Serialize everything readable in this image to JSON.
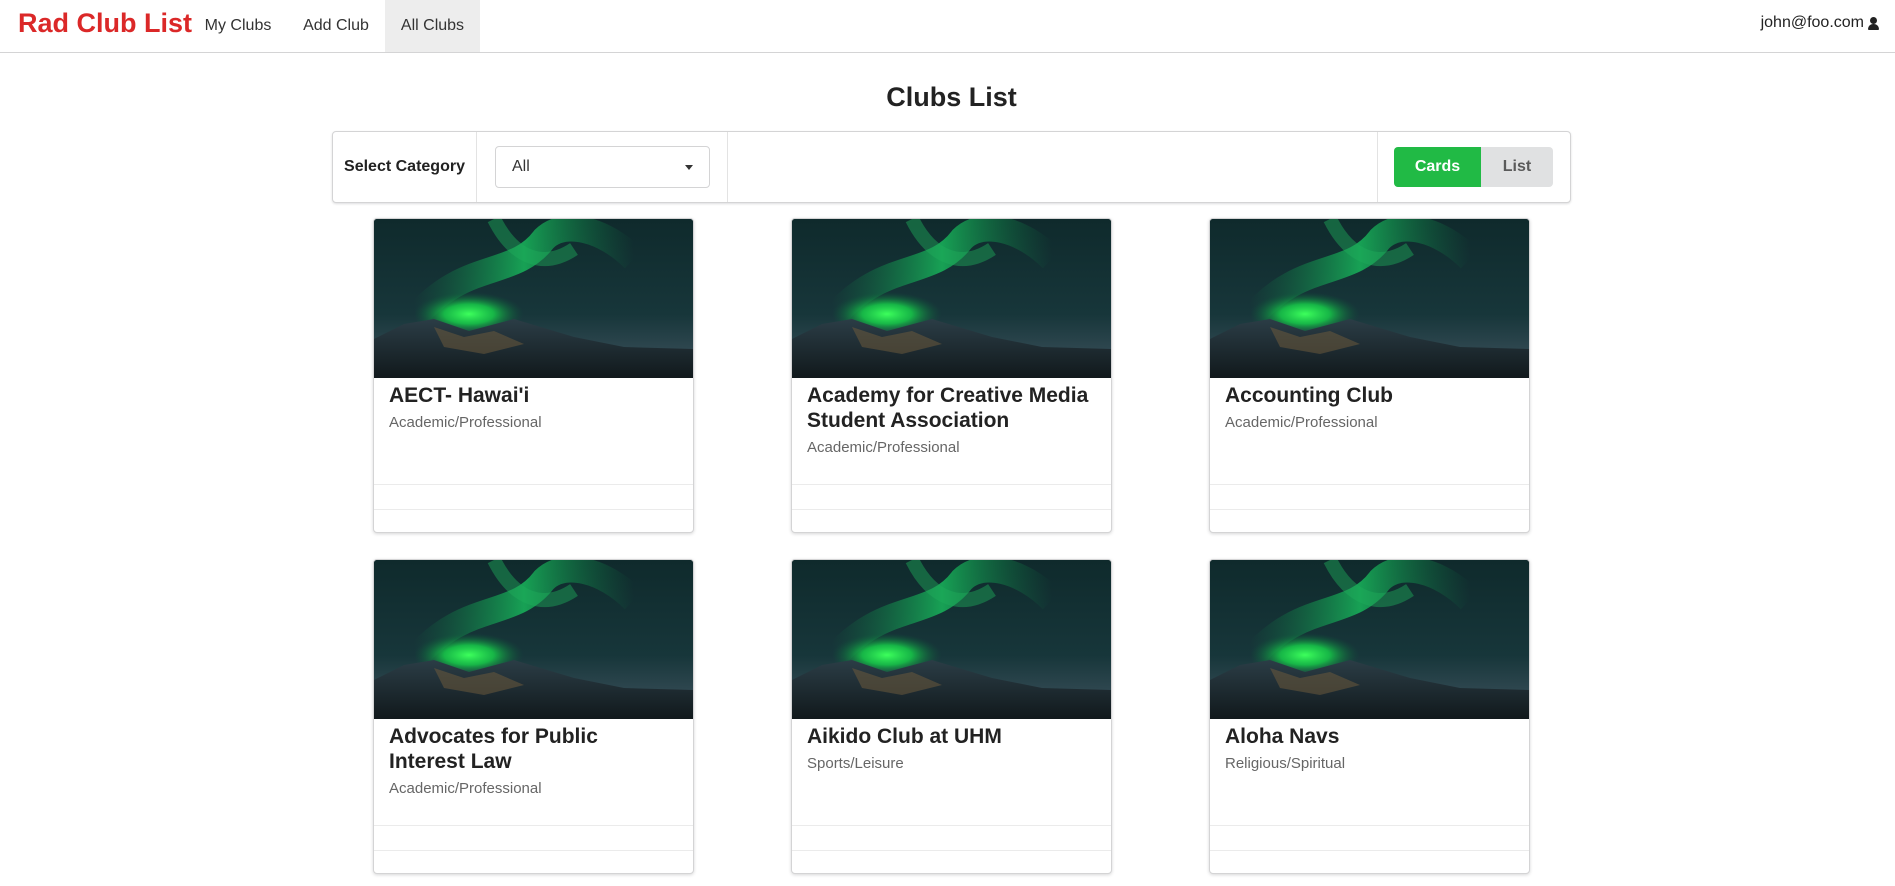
{
  "app": {
    "brand": "Rad Club List",
    "nav": [
      {
        "label": "My Clubs",
        "active": false
      },
      {
        "label": "Add Club",
        "active": false
      },
      {
        "label": "All Clubs",
        "active": true
      }
    ],
    "user_email": "john@foo.com",
    "user_icon": "user-icon"
  },
  "page": {
    "title": "Clubs List"
  },
  "filter": {
    "label": "Select Category",
    "selected": "All",
    "view_toggle": {
      "cards_label": "Cards",
      "list_label": "List",
      "active": "Cards"
    }
  },
  "colors": {
    "brand_red": "#db2828",
    "active_green": "#21ba45",
    "inactive_grey": "#e0e1e2"
  },
  "clubs": [
    {
      "name": "AECT- Hawai'i",
      "category": "Academic/Professional"
    },
    {
      "name": "Academy for Creative Media Student Association",
      "category": "Academic/Professional"
    },
    {
      "name": "Accounting Club",
      "category": "Academic/Professional"
    },
    {
      "name": "Advocates for Public Interest Law",
      "category": "Academic/Professional"
    },
    {
      "name": "Aikido Club at UHM",
      "category": "Sports/Leisure"
    },
    {
      "name": "Aloha Navs",
      "category": "Religious/Spiritual"
    }
  ]
}
